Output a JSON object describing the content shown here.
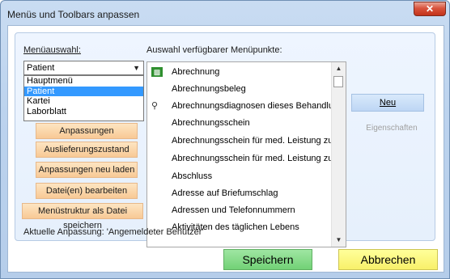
{
  "window": {
    "title": "Menüs und Toolbars anpassen",
    "close_glyph": "✕"
  },
  "labels": {
    "menu_select": "Menüauswahl:",
    "available_items": "Auswahl verfügbarer Menüpunkte:"
  },
  "combo": {
    "value": "Patient",
    "arrow": "▼"
  },
  "dropdown_options": [
    "Hauptmenü",
    "Patient",
    "Kartei",
    "Laborblatt"
  ],
  "dropdown_selected": "Patient",
  "side_buttons": {
    "export": "Anpassungen exportieren",
    "delivery": "Auslieferungszustand",
    "reload": "Anpassungen neu laden",
    "edit_files": "Datei(en) bearbeiten",
    "save_structure": "Menüstruktur als Datei speichern"
  },
  "menu_items": [
    {
      "icon": "▩",
      "icon_name": "invoice-icon",
      "label": "Abrechnung"
    },
    {
      "icon": "",
      "icon_name": "",
      "label": "Abrechnungsbeleg"
    },
    {
      "icon": "⚲",
      "icon_name": "stethoscope-icon",
      "label": "Abrechnungsdiagnosen dieses Behandlur"
    },
    {
      "icon": "",
      "icon_name": "",
      "label": "Abrechnungsschein"
    },
    {
      "icon": "",
      "icon_name": "",
      "label": "Abrechnungsschein für med. Leistung zu"
    },
    {
      "icon": "",
      "icon_name": "",
      "label": "Abrechnungsschein für med. Leistung zu"
    },
    {
      "icon": "",
      "icon_name": "",
      "label": "Abschluss"
    },
    {
      "icon": "",
      "icon_name": "",
      "label": "Adresse auf Briefumschlag"
    },
    {
      "icon": "",
      "icon_name": "",
      "label": "Adressen und Telefonnummern"
    },
    {
      "icon": "",
      "icon_name": "",
      "label": "Aktivitäten des täglichen Lebens"
    }
  ],
  "scrollbar": {
    "up": "▲",
    "down": "▼"
  },
  "buttons": {
    "new": "Neu",
    "properties": "Eigenschaften",
    "save": "Speichern",
    "cancel": "Abbrechen"
  },
  "status": "Aktuelle Anpassung: 'Angemeldeter Benutzer'",
  "colors": {
    "accent_selection": "#3399ff",
    "save": "#7ed683",
    "cancel": "#f9f27a",
    "side_button": "#fbd6a9"
  }
}
